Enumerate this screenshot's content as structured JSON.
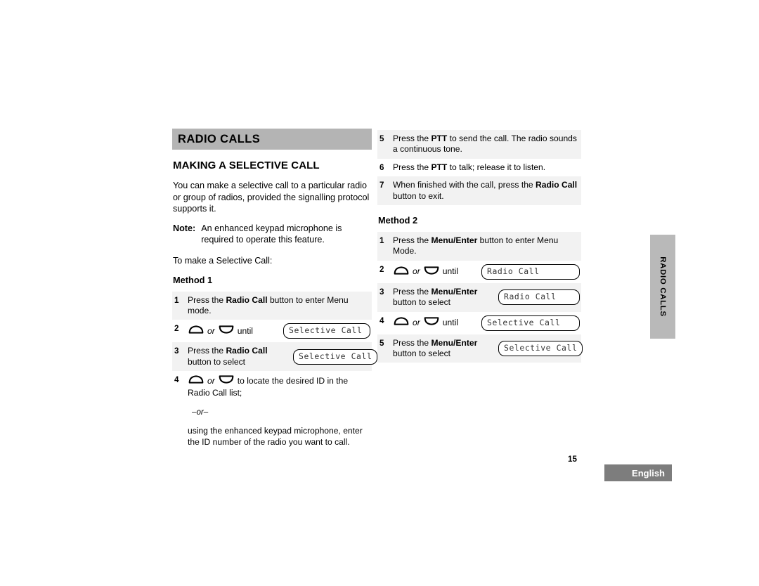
{
  "chapter": {
    "bar_title": "RADIO CALLS",
    "side_tab_label": "RADIO CALLS"
  },
  "section": {
    "title": "MAKING A SELECTIVE CALL",
    "intro": "You can make a selective call to a particular radio or group of radios, provided the signalling protocol supports it.",
    "note_label": "Note:",
    "note_line1": "An enhanced keypad microphone is",
    "note_line2": "required to operate this feature.",
    "lead": "To make a Selective Call:"
  },
  "icons": {
    "up": "up-arrow-button-icon",
    "down": "down-arrow-button-icon"
  },
  "labels": {
    "or_italic": "or",
    "until": "until",
    "or_divider": "–or–"
  },
  "method1": {
    "heading": "Method 1",
    "steps": [
      {
        "num": "1",
        "shaded": true,
        "type": "text",
        "text_parts": [
          {
            "t": "Press the ",
            "b": false
          },
          {
            "t": "Radio Call",
            "b": true
          },
          {
            "t": " button to enter Menu mode.",
            "b": false
          }
        ]
      },
      {
        "num": "2",
        "shaded": false,
        "type": "nav-lcd",
        "tail": "until",
        "lcd": "Selective Call"
      },
      {
        "num": "3",
        "shaded": true,
        "type": "text-lcd",
        "text_parts": [
          {
            "t": "Press the ",
            "b": false
          },
          {
            "t": "Radio Call",
            "b": true
          },
          {
            "t": " button to select",
            "b": false
          }
        ],
        "lcd": "Selective Call"
      },
      {
        "num": "4",
        "shaded": false,
        "type": "nav-text",
        "tail": "to locate the desired ID in the",
        "line2": "Radio Call list;",
        "or_divider": "–or–",
        "para": "using the enhanced keypad microphone, enter the ID number of the radio you want to call."
      }
    ]
  },
  "method1_cont": {
    "steps": [
      {
        "num": "5",
        "shaded": true,
        "type": "text",
        "text_parts": [
          {
            "t": "Press the ",
            "b": false
          },
          {
            "t": "PTT",
            "b": true
          },
          {
            "t": " to send the call. The radio sounds a continuous tone.",
            "b": false
          }
        ]
      },
      {
        "num": "6",
        "shaded": false,
        "type": "text",
        "text_parts": [
          {
            "t": "Press the ",
            "b": false
          },
          {
            "t": "PTT",
            "b": true
          },
          {
            "t": " to talk; release it to listen.",
            "b": false
          }
        ]
      },
      {
        "num": "7",
        "shaded": true,
        "type": "text",
        "text_parts": [
          {
            "t": "When finished with the call, press the ",
            "b": false
          },
          {
            "t": "Radio Call",
            "b": true
          },
          {
            "t": " button to exit.",
            "b": false
          }
        ]
      }
    ]
  },
  "method2": {
    "heading": "Method 2",
    "steps": [
      {
        "num": "1",
        "shaded": true,
        "type": "text",
        "text_parts": [
          {
            "t": "Press the ",
            "b": false
          },
          {
            "t": "Menu/Enter",
            "b": true
          },
          {
            "t": " button to enter Menu Mode.",
            "b": false
          }
        ]
      },
      {
        "num": "2",
        "shaded": false,
        "type": "nav-lcd",
        "tail": "until",
        "lcd": "Radio Call"
      },
      {
        "num": "3",
        "shaded": true,
        "type": "text-lcd",
        "text_parts": [
          {
            "t": "Press the ",
            "b": false
          },
          {
            "t": "Menu/Enter",
            "b": true
          },
          {
            "t": " button to select",
            "b": false
          }
        ],
        "lcd": "Radio Call"
      },
      {
        "num": "4",
        "shaded": false,
        "type": "nav-lcd",
        "tail": "until",
        "lcd": "Selective Call"
      },
      {
        "num": "5",
        "shaded": true,
        "type": "text-lcd",
        "text_parts": [
          {
            "t": "Press the ",
            "b": false
          },
          {
            "t": "Menu/Enter",
            "b": true
          },
          {
            "t": " button to select",
            "b": false
          }
        ],
        "lcd": "Selective Call"
      }
    ]
  },
  "footer": {
    "page_number": "15",
    "language": "English"
  },
  "colors": {
    "chapter_bar": "#b4b4b4",
    "side_tab": "#b9b9b9",
    "row_shade": "#f2f2f2",
    "lang_badge": "#7d7d7d"
  }
}
